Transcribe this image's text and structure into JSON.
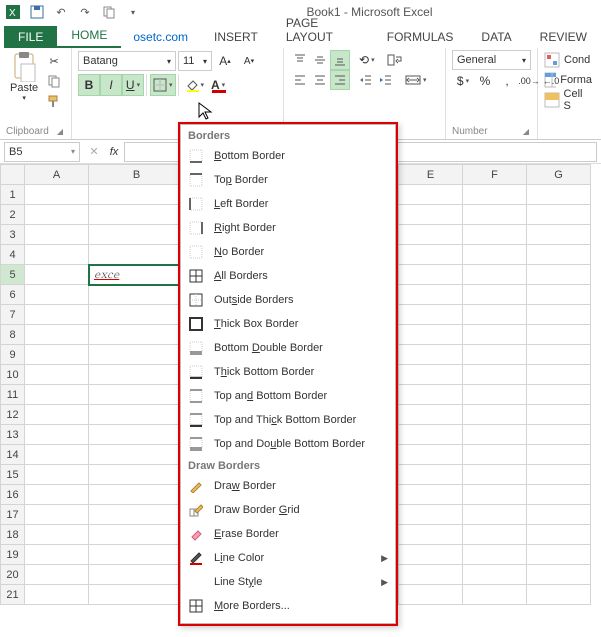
{
  "app": {
    "title": "Book1 - Microsoft Excel"
  },
  "tabs": {
    "file": "FILE",
    "home": "HOME",
    "link": "osetc.com",
    "insert": "INSERT",
    "page_layout": "PAGE LAYOUT",
    "formulas": "FORMULAS",
    "data": "DATA",
    "review": "REVIEW"
  },
  "ribbon": {
    "clipboard": {
      "paste": "Paste",
      "label": "Clipboard"
    },
    "font": {
      "name": "Batang",
      "size": "11",
      "bold": "B",
      "italic": "I",
      "underline": "U"
    },
    "number": {
      "format": "General",
      "label": "Number"
    },
    "styles": {
      "cond": "Cond",
      "format": "Forma",
      "cell": "Cell S"
    }
  },
  "name_box": {
    "ref": "B5"
  },
  "columns": [
    "A",
    "B",
    "E",
    "F",
    "G"
  ],
  "rows": [
    "1",
    "2",
    "3",
    "4",
    "5",
    "6",
    "7",
    "8",
    "9",
    "10",
    "11",
    "12",
    "13",
    "14",
    "15",
    "16",
    "17",
    "18",
    "19",
    "20",
    "21"
  ],
  "cell_b5": "exce",
  "borders_menu": {
    "h1": "Borders",
    "items1": [
      "Bottom Border",
      "Top Border",
      "Left Border",
      "Right Border",
      "No Border",
      "All Borders",
      "Outside Borders",
      "Thick Box Border",
      "Bottom Double Border",
      "Thick Bottom Border",
      "Top and Bottom Border",
      "Top and Thick Bottom Border",
      "Top and Double Bottom Border"
    ],
    "h2": "Draw Borders",
    "items2": [
      "Draw Border",
      "Draw Border Grid",
      "Erase Border",
      "Line Color",
      "Line Style",
      "More Borders..."
    ]
  }
}
